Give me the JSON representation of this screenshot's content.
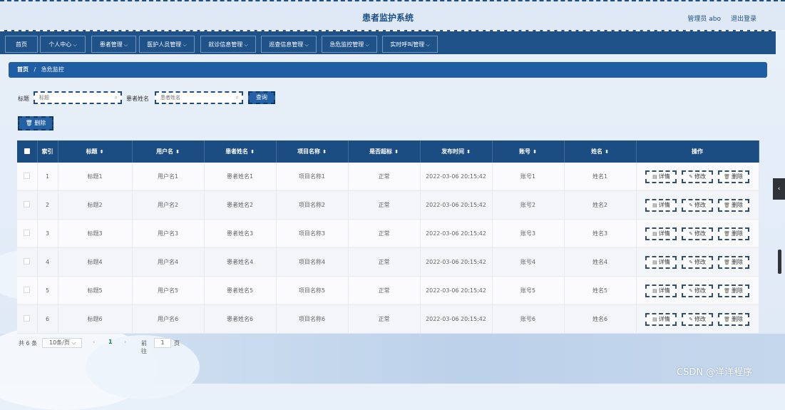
{
  "header": {
    "title": "患者监护系统",
    "user": "管理员 abo",
    "logout": "退出登录"
  },
  "nav": [
    {
      "label": "首页",
      "dropdown": false
    },
    {
      "label": "个人中心",
      "dropdown": true
    },
    {
      "label": "患者管理",
      "dropdown": true
    },
    {
      "label": "医护人员管理",
      "dropdown": true
    },
    {
      "label": "就诊信息管理",
      "dropdown": true
    },
    {
      "label": "巡查信息管理",
      "dropdown": true
    },
    {
      "label": "急危监控管理",
      "dropdown": true
    },
    {
      "label": "实时呼叫管理",
      "dropdown": true
    }
  ],
  "breadcrumb": {
    "home": "首页",
    "sep": "/",
    "current": "急危监控"
  },
  "search": {
    "title_label": "标题",
    "title_placeholder": "标题",
    "name_label": "患者姓名",
    "name_placeholder": "患者姓名",
    "query_button": "查询"
  },
  "toolbar": {
    "delete_button": "删除"
  },
  "table": {
    "columns": [
      "索引",
      "标题",
      "用户名",
      "患者姓名",
      "项目名称",
      "是否超标",
      "发布时间",
      "账号",
      "姓名",
      "操作"
    ],
    "rows": [
      {
        "index": "1",
        "title": "标题1",
        "username": "用户名1",
        "patient": "患者姓名1",
        "project": "项目名称1",
        "status": "正常",
        "time": "2022-03-06 20:15:42",
        "account": "账号1",
        "name": "姓名1"
      },
      {
        "index": "2",
        "title": "标题2",
        "username": "用户名2",
        "patient": "患者姓名2",
        "project": "项目名称2",
        "status": "正常",
        "time": "2022-03-06 20:15:42",
        "account": "账号2",
        "name": "姓名2"
      },
      {
        "index": "3",
        "title": "标题3",
        "username": "用户名3",
        "patient": "患者姓名3",
        "project": "项目名称3",
        "status": "正常",
        "time": "2022-03-06 20:15:42",
        "account": "账号3",
        "name": "姓名3"
      },
      {
        "index": "4",
        "title": "标题4",
        "username": "用户名4",
        "patient": "患者姓名4",
        "project": "项目名称4",
        "status": "正常",
        "time": "2022-03-06 20:15:42",
        "account": "账号4",
        "name": "姓名4"
      },
      {
        "index": "5",
        "title": "标题5",
        "username": "用户名5",
        "patient": "患者姓名5",
        "project": "项目名称5",
        "status": "正常",
        "time": "2022-03-06 20:15:42",
        "account": "账号5",
        "name": "姓名5"
      },
      {
        "index": "6",
        "title": "标题6",
        "username": "用户名6",
        "patient": "患者姓名6",
        "project": "项目名称6",
        "status": "正常",
        "time": "2022-03-06 20:15:42",
        "account": "账号6",
        "name": "姓名6"
      }
    ],
    "actions": {
      "detail": "详情",
      "edit": "修改",
      "delete": "删除"
    }
  },
  "pagination": {
    "total": "共 6 条",
    "page_size": "10条/页",
    "current_page": "1",
    "goto": "前往",
    "goto_value": "1",
    "page_suffix": "页"
  },
  "watermark": "CSDN @洋洋程序",
  "icons": {
    "sort": "sort-caret-icon",
    "search": "search-icon",
    "trash": "trash-icon",
    "detail": "document-icon",
    "edit": "pencil-icon",
    "chevron": "chevron-down-icon"
  },
  "colors": {
    "primary": "#1f5288",
    "breadcrumb": "#1f5ea4",
    "table_header": "#1b4c82",
    "page_active": "#1b8a4a"
  }
}
